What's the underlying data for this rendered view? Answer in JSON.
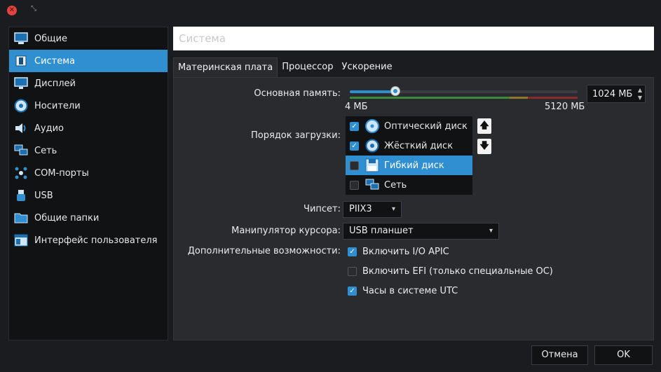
{
  "window": {
    "close_icon": "close-icon",
    "minimize_icon": "restore-icon"
  },
  "sidebar": {
    "items": [
      {
        "label": "Общие",
        "icon": "monitor-general-icon",
        "selected": false
      },
      {
        "label": "Система",
        "icon": "chip-system-icon",
        "selected": true
      },
      {
        "label": "Дисплей",
        "icon": "display-icon",
        "selected": false
      },
      {
        "label": "Носители",
        "icon": "storage-disk-icon",
        "selected": false
      },
      {
        "label": "Аудио",
        "icon": "speaker-icon",
        "selected": false
      },
      {
        "label": "Сеть",
        "icon": "network-icon",
        "selected": false
      },
      {
        "label": "COM-порты",
        "icon": "serial-port-icon",
        "selected": false
      },
      {
        "label": "USB",
        "icon": "usb-icon",
        "selected": false
      },
      {
        "label": "Общие папки",
        "icon": "shared-folder-icon",
        "selected": false
      },
      {
        "label": "Интерфейс пользователя",
        "icon": "user-interface-icon",
        "selected": false
      }
    ]
  },
  "page": {
    "title": "Система"
  },
  "tabs": [
    {
      "label": "Материнская плата",
      "active": true
    },
    {
      "label": "Процессор",
      "active": false
    },
    {
      "label": "Ускорение",
      "active": false
    }
  ],
  "motherboard": {
    "memory_label": "Основная память:",
    "memory_min": "4 МБ",
    "memory_max": "5120 МБ",
    "memory_value": "1024 МБ",
    "memory_slider_fraction": 0.2,
    "boot_order_label": "Порядок загрузки:",
    "boot_items": [
      {
        "label": "Оптический диск",
        "checked": true,
        "icon": "optical-disc-icon",
        "selected": false
      },
      {
        "label": "Жёсткий диск",
        "checked": true,
        "icon": "hard-disk-icon",
        "selected": false
      },
      {
        "label": "Гибкий диск",
        "checked": false,
        "icon": "floppy-disk-icon",
        "selected": true
      },
      {
        "label": "Сеть",
        "checked": false,
        "icon": "network-icon",
        "selected": false
      }
    ],
    "move_up_icon": "arrow-up-icon",
    "move_down_icon": "arrow-down-icon",
    "chipset_label": "Чипсет:",
    "chipset_value": "PIIX3",
    "pointing_label": "Манипулятор курсора:",
    "pointing_value": "USB планшет",
    "features_label": "Дополнительные возможности:",
    "features": [
      {
        "label": "Включить I/O APIC",
        "checked": true
      },
      {
        "label": "Включить EFI (только специальные ОС)",
        "checked": false
      },
      {
        "label": "Часы в системе UTC",
        "checked": true
      }
    ]
  },
  "buttons": {
    "cancel": "Отмена",
    "ok": "OK"
  },
  "colors": {
    "accent": "#2f8fd0",
    "scale_green": "#3a8a3a",
    "scale_yellow": "#8a7a2a",
    "scale_red": "#8a2a2a"
  }
}
